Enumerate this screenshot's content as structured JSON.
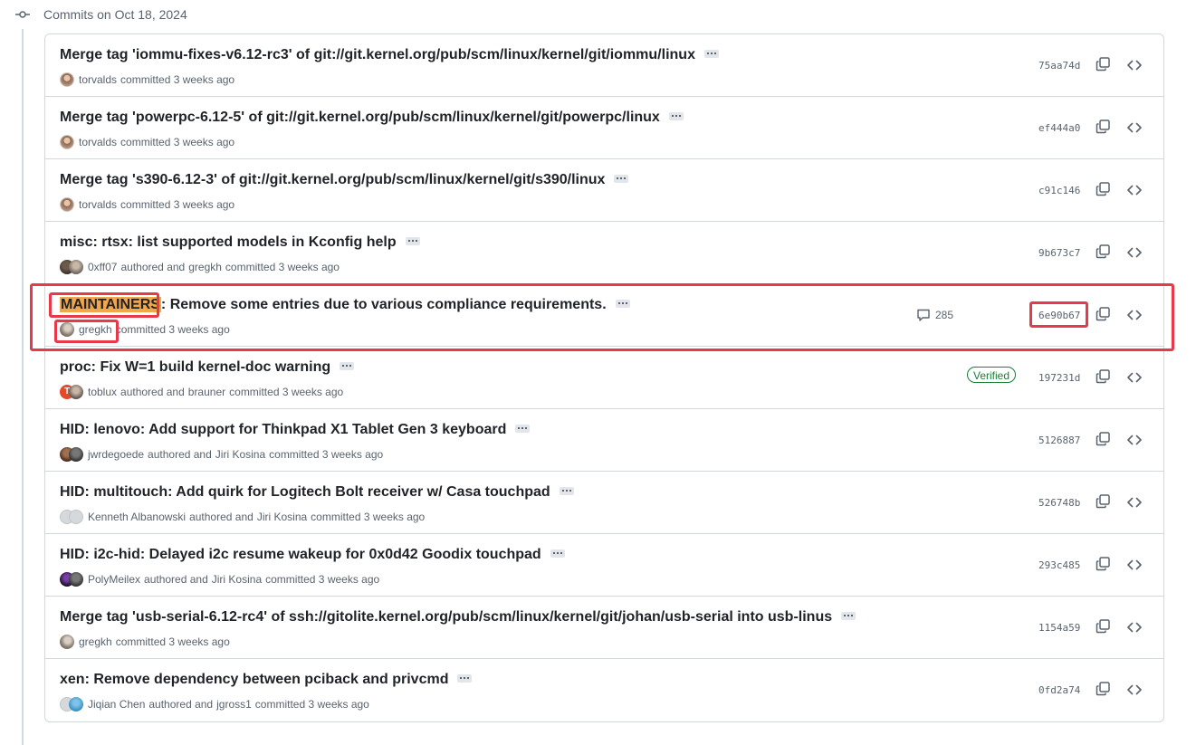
{
  "group": {
    "title": "Commits on Oct 18, 2024"
  },
  "commits": [
    {
      "title": "Merge tag 'iommu-fixes-v6.12-rc3' of git://git.kernel.org/pub/scm/linux/kernel/git/iommu/linux",
      "authors": [
        "torvalds"
      ],
      "author_line": "committed 3 weeks ago",
      "sha": "75aa74d"
    },
    {
      "title": "Merge tag 'powerpc-6.12-5' of git://git.kernel.org/pub/scm/linux/kernel/git/powerpc/linux",
      "authors": [
        "torvalds"
      ],
      "author_line": "committed 3 weeks ago",
      "sha": "ef444a0"
    },
    {
      "title": "Merge tag 's390-6.12-3' of git://git.kernel.org/pub/scm/linux/kernel/git/s390/linux",
      "authors": [
        "torvalds"
      ],
      "author_line": "committed 3 weeks ago",
      "sha": "c91c146"
    },
    {
      "title": "misc: rtsx: list supported models in Kconfig help",
      "author": "0xff07",
      "mid": "authored and",
      "committer": "gregkh",
      "tail": "committed 3 weeks ago",
      "sha": "9b673c7"
    },
    {
      "title_prefix": "MAINTAINERS",
      "title_rest": ": Remove some entries due to various compliance requirements.",
      "author": "gregkh",
      "tail": "committed 3 weeks ago",
      "comments": "285",
      "sha": "6e90b67"
    },
    {
      "title": "proc: Fix W=1 build kernel-doc warning",
      "author": "toblux",
      "mid": "authored and",
      "committer": "brauner",
      "tail": "committed 3 weeks ago",
      "badge": "Verified",
      "sha": "197231d"
    },
    {
      "title": "HID: lenovo: Add support for Thinkpad X1 Tablet Gen 3 keyboard",
      "author": "jwrdegoede",
      "mid": "authored and",
      "committer": "Jiri Kosina",
      "tail": "committed 3 weeks ago",
      "sha": "5126887"
    },
    {
      "title": "HID: multitouch: Add quirk for Logitech Bolt receiver w/ Casa touchpad",
      "author": "Kenneth Albanowski",
      "mid": "authored and",
      "committer": "Jiri Kosina",
      "tail": "committed 3 weeks ago",
      "sha": "526748b"
    },
    {
      "title": "HID: i2c-hid: Delayed i2c resume wakeup for 0x0d42 Goodix touchpad",
      "author": "PolyMeilex",
      "mid": "authored and",
      "committer": "Jiri Kosina",
      "tail": "committed 3 weeks ago",
      "sha": "293c485"
    },
    {
      "title": "Merge tag 'usb-serial-6.12-rc4' of ssh://gitolite.kernel.org/pub/scm/linux/kernel/git/johan/usb-serial into usb-linus",
      "author": "gregkh",
      "tail": "committed 3 weeks ago",
      "sha": "1154a59"
    },
    {
      "title": "xen: Remove dependency between pciback and privcmd",
      "author": "Jiqian Chen",
      "mid": "authored and",
      "committer": "jgross1",
      "tail": "committed 3 weeks ago",
      "sha": "0fd2a74"
    }
  ],
  "colors": {
    "highlight": "#f0a74a",
    "annotation_red": "#e8394a",
    "verified_green": "#1a7f37"
  },
  "icons": {
    "group": "git-commit-icon",
    "more": "ellipsis-icon",
    "comment": "comment-icon",
    "copy": "copy-icon",
    "browse": "code-icon"
  }
}
